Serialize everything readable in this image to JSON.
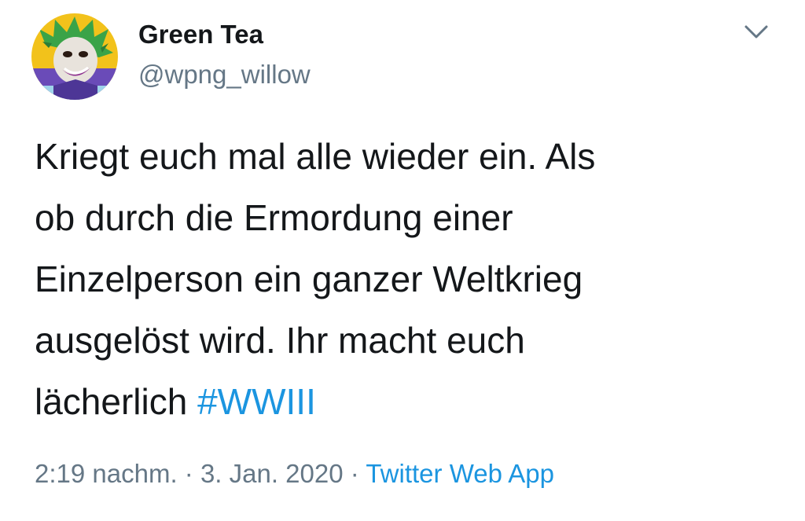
{
  "user": {
    "display_name": "Green Tea",
    "handle": "@wpng_willow",
    "avatar_icon": "joker-avatar-icon"
  },
  "menu": {
    "icon": "chevron-down-icon"
  },
  "tweet": {
    "text_lines": [
      "Kriegt euch mal alle wieder ein. Als",
      "ob durch die Ermordung einer",
      "Einzelperson ein ganzer Weltkrieg",
      "ausgelöst wird. Ihr macht euch",
      "lächerlich "
    ],
    "hashtag": "#WWIII"
  },
  "meta": {
    "time": "2:19 nachm.",
    "separator": " · ",
    "date": "3. Jan. 2020",
    "separator2": " · ",
    "source": "Twitter Web App"
  },
  "colors": {
    "link": "#1b95e0",
    "secondary_text": "#657786",
    "primary_text": "#14171a"
  }
}
